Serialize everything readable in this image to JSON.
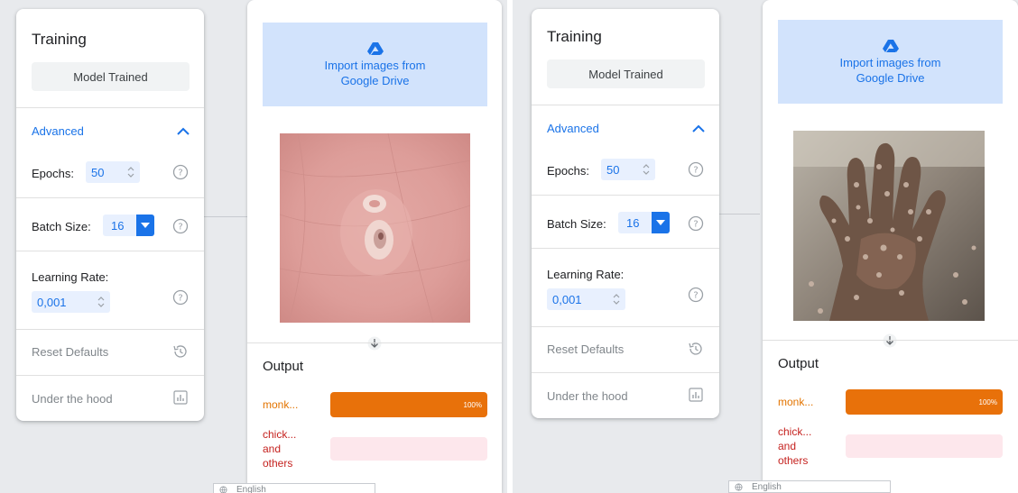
{
  "panels": [
    {
      "training": {
        "title": "Training",
        "model_button": "Model Trained",
        "advanced_label": "Advanced",
        "epochs_label": "Epochs:",
        "epochs_value": "50",
        "batch_label": "Batch Size:",
        "batch_value": "16",
        "lr_label": "Learning Rate:",
        "lr_value": "0,001",
        "reset_label": "Reset Defaults",
        "hood_label": "Under the hood"
      },
      "image_card": {
        "import_line1": "Import images from",
        "import_line2": "Google Drive"
      },
      "output": {
        "title": "Output",
        "class1": "monk...",
        "class1_percent": "100%",
        "class2_line1": "chick...",
        "class2_line2": "and",
        "class2_line3": "others",
        "class1_confidence": 1.0,
        "class2_confidence": 0.0
      },
      "footer": {
        "language": "English"
      }
    },
    {
      "training": {
        "title": "Training",
        "model_button": "Model Trained",
        "advanced_label": "Advanced",
        "epochs_label": "Epochs:",
        "epochs_value": "50",
        "batch_label": "Batch Size:",
        "batch_value": "16",
        "lr_label": "Learning Rate:",
        "lr_value": "0,001",
        "reset_label": "Reset Defaults",
        "hood_label": "Under the hood"
      },
      "image_card": {
        "import_line1": "Import images from",
        "import_line2": "Google Drive"
      },
      "output": {
        "title": "Output",
        "class1": "monk...",
        "class1_percent": "100%",
        "class2_line1": "chick...",
        "class2_line2": "and",
        "class2_line3": "others",
        "class1_confidence": 1.0,
        "class2_confidence": 0.0
      },
      "footer": {
        "language": "English"
      }
    }
  ],
  "colors": {
    "accent": "#1a73e8",
    "import_bg": "#d2e3fc",
    "class1": "#e8710a",
    "class2_text": "#c5221f",
    "class2_bar": "#fde7ec"
  },
  "icons": [
    "google-drive-icon",
    "chevron-up-icon",
    "help-icon",
    "spinner-icon",
    "dropdown-arrow-icon",
    "history-icon",
    "bar-chart-icon",
    "arrow-down-icon",
    "globe-icon"
  ]
}
